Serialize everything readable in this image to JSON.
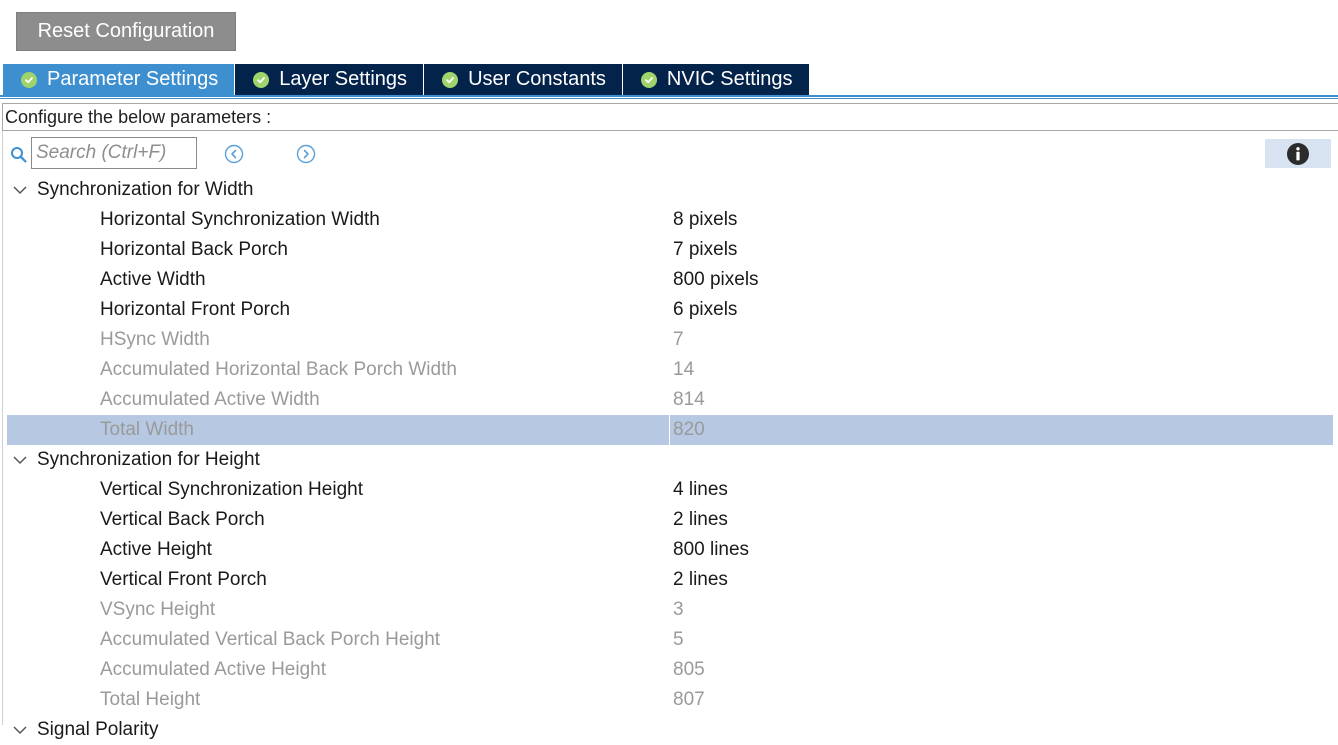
{
  "toolbar": {
    "reset_label": "Reset Configuration"
  },
  "tabs": [
    {
      "label": "Parameter Settings",
      "active": true
    },
    {
      "label": "Layer Settings",
      "active": false
    },
    {
      "label": "User Constants",
      "active": false
    },
    {
      "label": "NVIC Settings",
      "active": false
    }
  ],
  "config_prompt": "Configure the below parameters :",
  "search": {
    "placeholder": "Search (Ctrl+F)"
  },
  "icons": {
    "search": "search-icon",
    "prev": "circle-chevron-left-icon",
    "next": "circle-chevron-right-icon",
    "info": "info-icon",
    "check": "check-circle-icon",
    "expand": "chevron-down-icon"
  },
  "colors": {
    "tab_active": "#3d8fd0",
    "tab_inactive": "#03234b",
    "check": "#9ed46b",
    "selected_row": "#b7c9e2",
    "readonly_text": "#9a9a9a"
  },
  "groups": [
    {
      "title": "Synchronization for Width",
      "rows": [
        {
          "label": "Horizontal Synchronization Width",
          "value": "8 pixels"
        },
        {
          "label": "Horizontal Back Porch",
          "value": "7 pixels"
        },
        {
          "label": "Active Width",
          "value": "800 pixels"
        },
        {
          "label": "Horizontal Front Porch",
          "value": "6 pixels"
        },
        {
          "label": "HSync Width",
          "value": "7"
        },
        {
          "label": "Accumulated Horizontal Back Porch Width",
          "value": "14"
        },
        {
          "label": "Accumulated Active Width",
          "value": "814"
        },
        {
          "label": "Total Width",
          "value": "820"
        }
      ]
    },
    {
      "title": "Synchronization for Height",
      "rows": [
        {
          "label": "Vertical Synchronization Height",
          "value": "4 lines"
        },
        {
          "label": "Vertical Back Porch",
          "value": "2 lines"
        },
        {
          "label": "Active Height",
          "value": "800 lines"
        },
        {
          "label": "Vertical Front Porch",
          "value": "2 lines"
        },
        {
          "label": "VSync Height",
          "value": "3"
        },
        {
          "label": "Accumulated Vertical Back Porch Height",
          "value": "5"
        },
        {
          "label": "Accumulated Active Height",
          "value": "805"
        },
        {
          "label": "Total Height",
          "value": "807"
        }
      ]
    },
    {
      "title": "Signal Polarity"
    }
  ]
}
